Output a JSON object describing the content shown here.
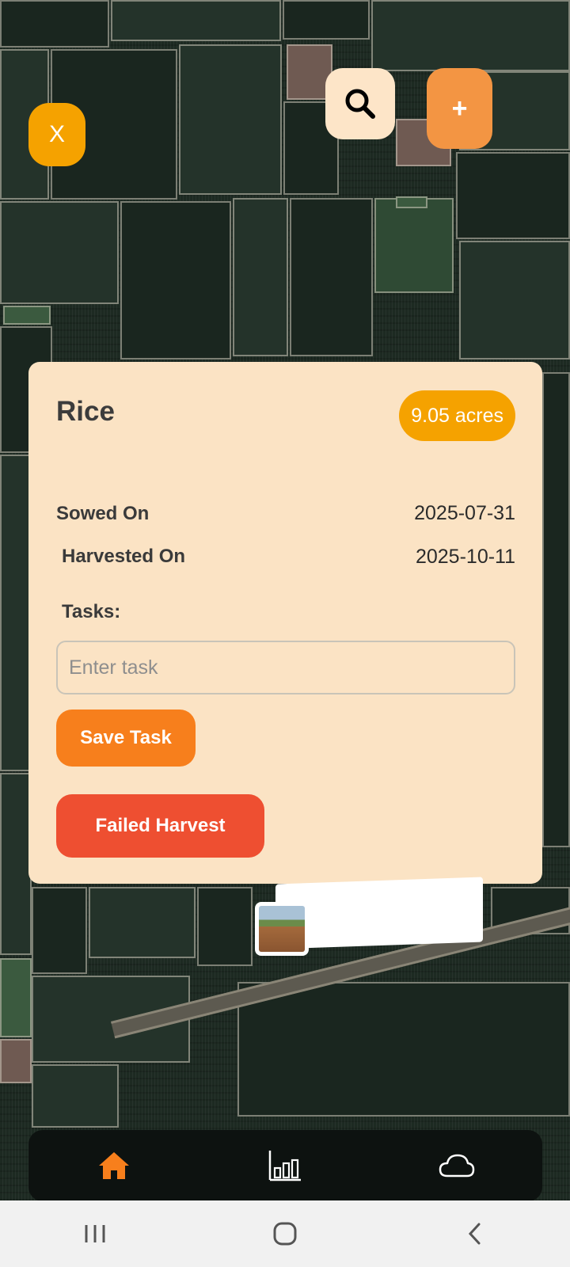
{
  "top_controls": {
    "close_label": "X",
    "search_icon": "search-icon",
    "add_label": "+"
  },
  "card": {
    "crop_name": "Rice",
    "area_badge": "9.05 acres",
    "sowed_label": "Sowed On",
    "sowed_value": "2025-07-31",
    "harvested_label": "Harvested On",
    "harvested_value": "2025-10-11",
    "tasks_label": "Tasks:",
    "task_input_value": "",
    "task_input_placeholder": "Enter task",
    "save_task_label": "Save Task",
    "failed_harvest_label": "Failed Harvest"
  },
  "bottom_nav": {
    "items": [
      {
        "icon": "home-icon",
        "active": true
      },
      {
        "icon": "bar-chart-icon",
        "active": false
      },
      {
        "icon": "cloud-icon",
        "active": false
      }
    ]
  },
  "system_nav": {
    "items": [
      "recent-apps-icon",
      "home-circle-icon",
      "back-icon"
    ]
  },
  "colors": {
    "accent_orange": "#f5a200",
    "save_button": "#f77f1c",
    "failed_button": "#ee4f31",
    "card_background": "#fbe3c4",
    "nav_active": "#f77f1c"
  }
}
